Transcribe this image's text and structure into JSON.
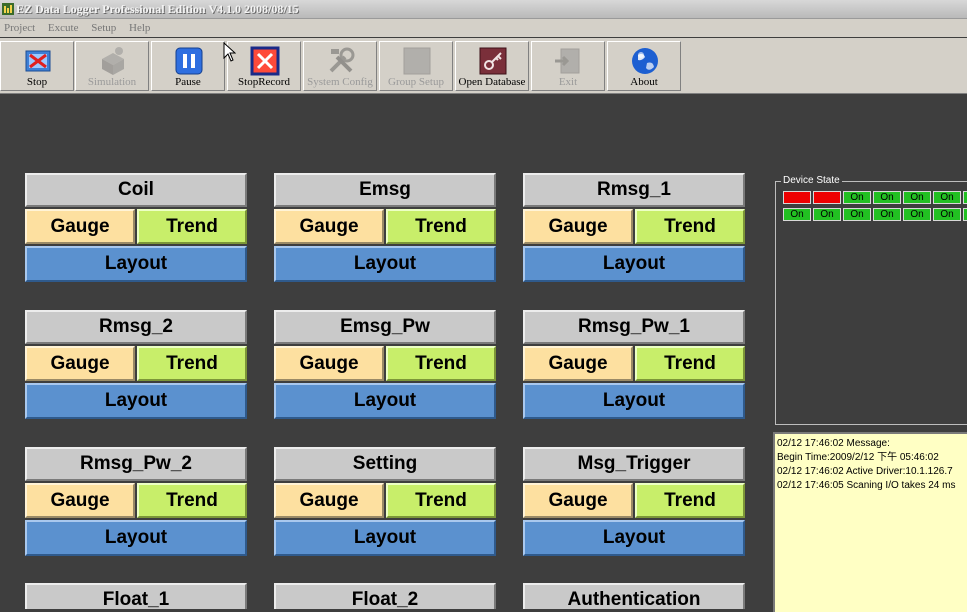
{
  "window": {
    "title": "EZ Data Logger Professional Edition V4.1.0 2008/08/15"
  },
  "menu": [
    "Project",
    "Excute",
    "Setup",
    "Help"
  ],
  "toolbar": [
    {
      "label": "Stop",
      "icon": "stop-icon",
      "enabled": true
    },
    {
      "label": "Simulation",
      "icon": "simulation-icon",
      "enabled": false
    },
    {
      "label": "Pause",
      "icon": "pause-icon",
      "enabled": true
    },
    {
      "label": "StopRecord",
      "icon": "stop-record-icon",
      "enabled": true
    },
    {
      "label": "System Config",
      "icon": "tools-icon",
      "enabled": false
    },
    {
      "label": "Group Setup",
      "icon": "group-icon",
      "enabled": false
    },
    {
      "label": "Open Database",
      "icon": "database-key-icon",
      "enabled": true
    },
    {
      "label": "Exit",
      "icon": "exit-icon",
      "enabled": false
    },
    {
      "label": "About",
      "icon": "globe-icon",
      "enabled": true
    }
  ],
  "panel_buttons": {
    "gauge": "Gauge",
    "trend": "Trend",
    "layout": "Layout"
  },
  "panels": [
    {
      "name": "Coil"
    },
    {
      "name": "Emsg"
    },
    {
      "name": "Rmsg_1"
    },
    {
      "name": "Rmsg_2"
    },
    {
      "name": "Emsg_Pw"
    },
    {
      "name": "Rmsg_Pw_1"
    },
    {
      "name": "Rmsg_Pw_2"
    },
    {
      "name": "Setting"
    },
    {
      "name": "Msg_Trigger"
    },
    {
      "name": "Float_1"
    },
    {
      "name": "Float_2"
    },
    {
      "name": "Authentication"
    }
  ],
  "device_state": {
    "title": "Device State",
    "rows": [
      [
        {
          "label": "",
          "state": "off"
        },
        {
          "label": "",
          "state": "off"
        },
        {
          "label": "On",
          "state": "on"
        },
        {
          "label": "On",
          "state": "on"
        },
        {
          "label": "On",
          "state": "on"
        },
        {
          "label": "On",
          "state": "on"
        },
        {
          "label": "On",
          "state": "on"
        }
      ],
      [
        {
          "label": "On",
          "state": "on"
        },
        {
          "label": "On",
          "state": "on"
        },
        {
          "label": "On",
          "state": "on"
        },
        {
          "label": "On",
          "state": "on"
        },
        {
          "label": "On",
          "state": "on"
        },
        {
          "label": "On",
          "state": "on"
        },
        {
          "label": "On",
          "state": "on"
        }
      ]
    ],
    "colors": {
      "on": "#22c022",
      "off": "#ee0000"
    }
  },
  "log_lines": [
    "02/12 17:46:02  Message:",
    "Begin Time:2009/2/12 下午 05:46:02",
    "02/12 17:46:02  Active Driver:10.1.126.7",
    "02/12 17:46:05  Scaning I/O takes 24 ms"
  ]
}
